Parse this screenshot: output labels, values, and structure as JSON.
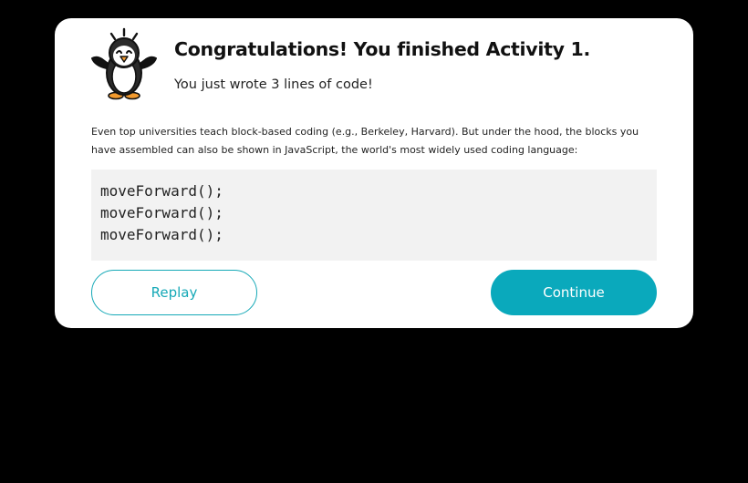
{
  "dialog": {
    "title": "Congratulations! You finished Activity 1.",
    "subtitle": "You just wrote 3 lines of code!",
    "description": "Even top universities teach block-based coding (e.g., Berkeley, Harvard). But under the hood, the blocks you have assembled can also be shown in JavaScript, the world's most widely used coding language:",
    "code_lines": [
      "moveForward();",
      "moveForward();",
      "moveForward();"
    ],
    "mascot_icon": "penguin-mascot-icon",
    "buttons": {
      "replay_label": "Replay",
      "continue_label": "Continue"
    },
    "colors": {
      "accent": "#0aa9bc",
      "background": "#000000",
      "code_background": "#f2f2f2"
    }
  }
}
